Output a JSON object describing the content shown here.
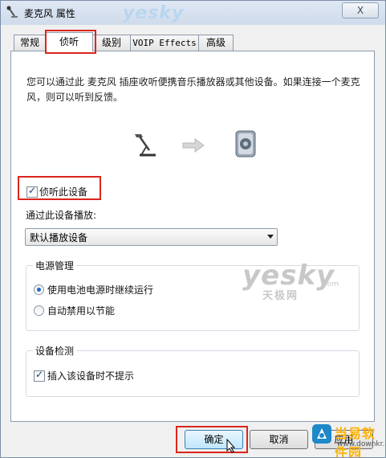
{
  "window": {
    "title": "麦克风 属性",
    "close_label": "X",
    "watermark": "yesky"
  },
  "tabs": [
    {
      "label": "常规"
    },
    {
      "label": "侦听"
    },
    {
      "label": "级别"
    },
    {
      "label": "VOIP Effects"
    },
    {
      "label": "高级"
    }
  ],
  "main": {
    "description": "您可以通过此 麦克风 插座收听便携音乐播放器或其他设备。如果连接一个麦克风，则可以听到反馈。",
    "listen_checkbox_label": "侦听此设备",
    "listen_checkbox_checked": true,
    "playback_label": "通过此设备播放:",
    "playback_device": "默认播放设备"
  },
  "power": {
    "title": "电源管理",
    "option1": "使用电池电源时继续运行",
    "option2": "自动禁用以节能",
    "selected": 1
  },
  "detection": {
    "title": "设备检测",
    "checkbox_label": "插入该设备时不提示",
    "checked": true
  },
  "watermark": {
    "main": "yesky",
    "sub": "天极网",
    "domain": ".com"
  },
  "buttons": {
    "ok": "确定",
    "cancel": "取消",
    "apply": "应用"
  },
  "site_logo": {
    "name": "当易软件园",
    "url": "www.downkr.com"
  },
  "colors": {
    "highlight": "#d9261c",
    "accent": "#1a6ad0",
    "logo": "#ffb300"
  }
}
